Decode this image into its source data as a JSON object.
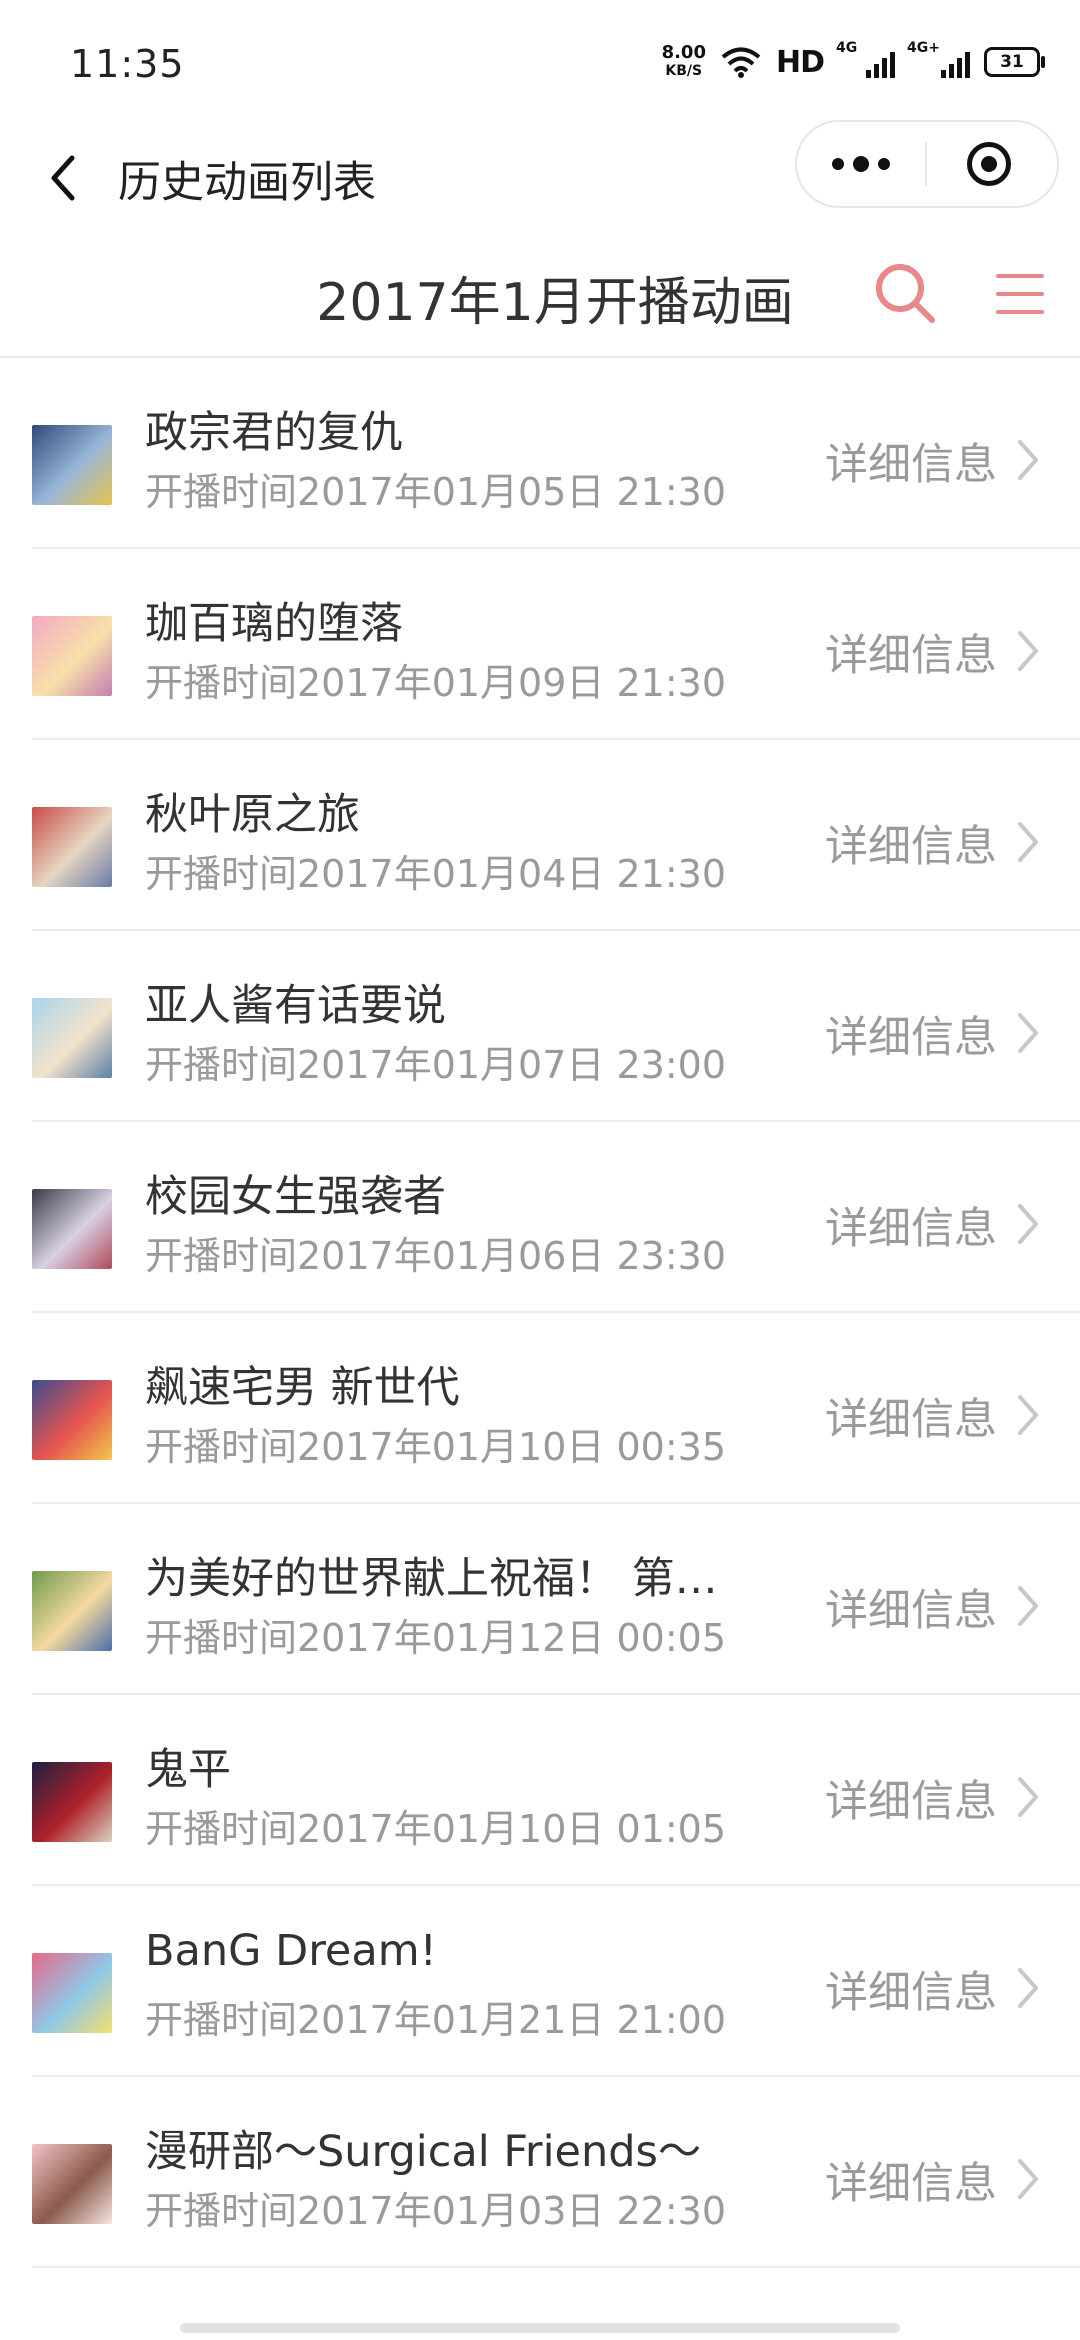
{
  "status_bar": {
    "time": "11:35",
    "net_speed": "8.00",
    "net_unit": "KB/S",
    "hd_label": "HD",
    "sig1_label": "4G",
    "sig2_label": "4G+",
    "battery": "31"
  },
  "nav": {
    "title": "历史动画列表"
  },
  "header": {
    "title": "2017年1月开播动画",
    "accent_color": "#e8888a"
  },
  "detail_label": "详细信息",
  "items": [
    {
      "title": "政宗君的复仇",
      "date": "开播时间2017年01月05日 21:30",
      "thumb_colors": [
        "#2e4a7a",
        "#9bb7d8",
        "#e7c24a"
      ]
    },
    {
      "title": "珈百璃的堕落",
      "date": "开播时间2017年01月09日 21:30",
      "thumb_colors": [
        "#f3a9c4",
        "#f7e0a8",
        "#c77db3"
      ]
    },
    {
      "title": "秋叶原之旅",
      "date": "开播时间2017年01月04日 21:30",
      "thumb_colors": [
        "#c94a4a",
        "#e6d6c0",
        "#6a7aa8"
      ]
    },
    {
      "title": "亚人酱有话要说",
      "date": "开播时间2017年01月07日 23:00",
      "thumb_colors": [
        "#a9d4ee",
        "#f3e2c9",
        "#5b7fa8"
      ]
    },
    {
      "title": "校园女生强袭者",
      "date": "开播时间2017年01月06日 23:30",
      "thumb_colors": [
        "#3a3a4a",
        "#d8d0e4",
        "#b04a5a"
      ]
    },
    {
      "title": "飙速宅男 新世代",
      "date": "开播时间2017年01月10日 00:35",
      "thumb_colors": [
        "#3b4b8f",
        "#e5554f",
        "#f1c84a"
      ]
    },
    {
      "title": "为美好的世界献上祝福！ 第二季",
      "date": "开播时间2017年01月12日 00:05",
      "thumb_colors": [
        "#6f9c4a",
        "#f4d9a0",
        "#4a6fa8"
      ]
    },
    {
      "title": "鬼平",
      "date": "开播时间2017年01月10日 01:05",
      "thumb_colors": [
        "#1b2240",
        "#b0202a",
        "#d9d2c2"
      ]
    },
    {
      "title": "BanG Dream!",
      "date": "开播时间2017年01月21日 21:00",
      "thumb_colors": [
        "#e66a8a",
        "#8fc7e8",
        "#f4e06a"
      ]
    },
    {
      "title": "漫研部～Surgical Friends～",
      "date": "开播时间2017年01月03日 22:30",
      "thumb_colors": [
        "#f2c2c9",
        "#8a5a4a",
        "#f7e6e0"
      ]
    }
  ]
}
